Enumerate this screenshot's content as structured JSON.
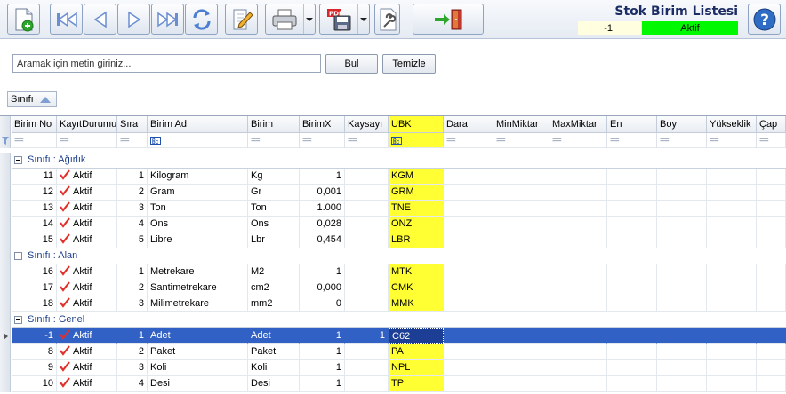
{
  "window": {
    "title": "Stok Birim Listesi",
    "record_id": "-1",
    "status": "Aktif"
  },
  "toolbar": {
    "buttons": [
      {
        "name": "new-record-button",
        "icon": "new-document-icon"
      },
      {
        "name": "first-record-button",
        "icon": "first-icon"
      },
      {
        "name": "prev-record-button",
        "icon": "prev-icon"
      },
      {
        "name": "next-record-button",
        "icon": "next-icon"
      },
      {
        "name": "last-record-button",
        "icon": "last-icon"
      },
      {
        "name": "refresh-button",
        "icon": "refresh-icon"
      },
      {
        "name": "edit-button",
        "icon": "edit-icon"
      },
      {
        "name": "print-button",
        "icon": "printer-icon"
      },
      {
        "name": "export-pdf-button",
        "icon": "pdf-save-icon"
      },
      {
        "name": "settings-button",
        "icon": "wrench-icon"
      },
      {
        "name": "exit-button",
        "icon": "exit-door-icon"
      },
      {
        "name": "help-button",
        "icon": "help-icon"
      }
    ]
  },
  "search": {
    "placeholder": "Aramak için metin giriniz...",
    "find_label": "Bul",
    "clear_label": "Temizle"
  },
  "group_panel": {
    "chip_label": "Sınıfı"
  },
  "grid": {
    "columns": [
      "Birim No",
      "KayıtDurumu",
      "Sıra",
      "Birim Adı",
      "Birim",
      "BirimX",
      "Kaysayı",
      "UBK",
      "Dara",
      "MinMiktar",
      "MaxMiktar",
      "En",
      "Boy",
      "Yükseklik",
      "Çap"
    ],
    "groups": [
      {
        "label": "Sınıfı : Ağırlık",
        "rows": [
          {
            "no": "11",
            "status": "Aktif",
            "sira": "1",
            "ad": "Kilogram",
            "birim": "Kg",
            "birimx": "1",
            "kaysayi": "",
            "ubk": "KGM"
          },
          {
            "no": "12",
            "status": "Aktif",
            "sira": "2",
            "ad": "Gram",
            "birim": "Gr",
            "birimx": "0,001",
            "kaysayi": "",
            "ubk": "GRM"
          },
          {
            "no": "13",
            "status": "Aktif",
            "sira": "3",
            "ad": "Ton",
            "birim": "Ton",
            "birimx": "1.000",
            "kaysayi": "",
            "ubk": "TNE"
          },
          {
            "no": "14",
            "status": "Aktif",
            "sira": "4",
            "ad": "Ons",
            "birim": "Ons",
            "birimx": "0,028",
            "kaysayi": "",
            "ubk": "ONZ"
          },
          {
            "no": "15",
            "status": "Aktif",
            "sira": "5",
            "ad": "Libre",
            "birim": "Lbr",
            "birimx": "0,454",
            "kaysayi": "",
            "ubk": "LBR"
          }
        ]
      },
      {
        "label": "Sınıfı : Alan",
        "rows": [
          {
            "no": "16",
            "status": "Aktif",
            "sira": "1",
            "ad": "Metrekare",
            "birim": "M2",
            "birimx": "1",
            "kaysayi": "",
            "ubk": "MTK"
          },
          {
            "no": "17",
            "status": "Aktif",
            "sira": "2",
            "ad": "Santimetrekare",
            "birim": "cm2",
            "birimx": "0,000",
            "kaysayi": "",
            "ubk": "CMK"
          },
          {
            "no": "18",
            "status": "Aktif",
            "sira": "3",
            "ad": "Milimetrekare",
            "birim": "mm2",
            "birimx": "0",
            "kaysayi": "",
            "ubk": "MMK"
          }
        ]
      },
      {
        "label": "Sınıfı : Genel",
        "rows": [
          {
            "no": "-1",
            "status": "Aktif",
            "sira": "1",
            "ad": "Adet",
            "birim": "Adet",
            "birimx": "1",
            "kaysayi": "1",
            "ubk": "C62",
            "selected": true
          },
          {
            "no": "8",
            "status": "Aktif",
            "sira": "2",
            "ad": "Paket",
            "birim": "Paket",
            "birimx": "1",
            "kaysayi": "",
            "ubk": "PA"
          },
          {
            "no": "9",
            "status": "Aktif",
            "sira": "3",
            "ad": "Koli",
            "birim": "Koli",
            "birimx": "1",
            "kaysayi": "",
            "ubk": "NPL"
          },
          {
            "no": "10",
            "status": "Aktif",
            "sira": "4",
            "ad": "Desi",
            "birim": "Desi",
            "birimx": "1",
            "kaysayi": "",
            "ubk": "TP"
          }
        ]
      }
    ]
  },
  "colors": {
    "active_status": "#00f800",
    "ubk_highlight": "#ffff33",
    "selection": "#3161c5",
    "title": "#1c2c64"
  }
}
